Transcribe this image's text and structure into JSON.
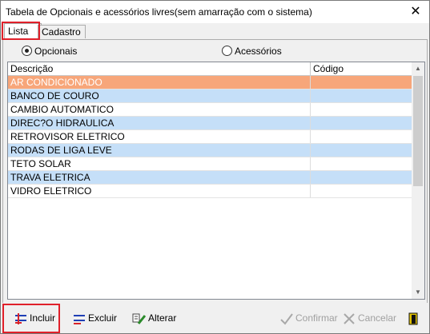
{
  "window": {
    "title": "Tabela de Opcionais e acessórios livres(sem amarração com o sistema)",
    "close_glyph": "✕"
  },
  "tabs": [
    {
      "label": "Lista",
      "active": true
    },
    {
      "label": "Cadastro",
      "active": false
    }
  ],
  "filter": {
    "options": [
      {
        "label": "Opcionais",
        "checked": true
      },
      {
        "label": "Acessórios",
        "checked": false
      }
    ]
  },
  "grid": {
    "columns": [
      "Descrição",
      "Código"
    ],
    "rows": [
      {
        "descricao": "AR CONDICIONADO",
        "codigo": ""
      },
      {
        "descricao": "BANCO DE COURO",
        "codigo": ""
      },
      {
        "descricao": "CAMBIO AUTOMATICO",
        "codigo": ""
      },
      {
        "descricao": "DIREC?O HIDRAULICA",
        "codigo": ""
      },
      {
        "descricao": "RETROVISOR ELETRICO",
        "codigo": ""
      },
      {
        "descricao": "RODAS DE LIGA LEVE",
        "codigo": ""
      },
      {
        "descricao": "TETO SOLAR",
        "codigo": ""
      },
      {
        "descricao": "TRAVA ELETRICA",
        "codigo": ""
      },
      {
        "descricao": "VIDRO ELETRICO",
        "codigo": ""
      }
    ],
    "selected_row": 0,
    "colors": {
      "selected": "#f7a67a",
      "alternate": "#c5dff8"
    }
  },
  "toolbar": {
    "incluir": "Incluir",
    "excluir": "Excluir",
    "alterar": "Alterar",
    "confirmar": "Confirmar",
    "cancelar": "Cancelar"
  },
  "colors": {
    "highlight_border": "#e0202a"
  }
}
